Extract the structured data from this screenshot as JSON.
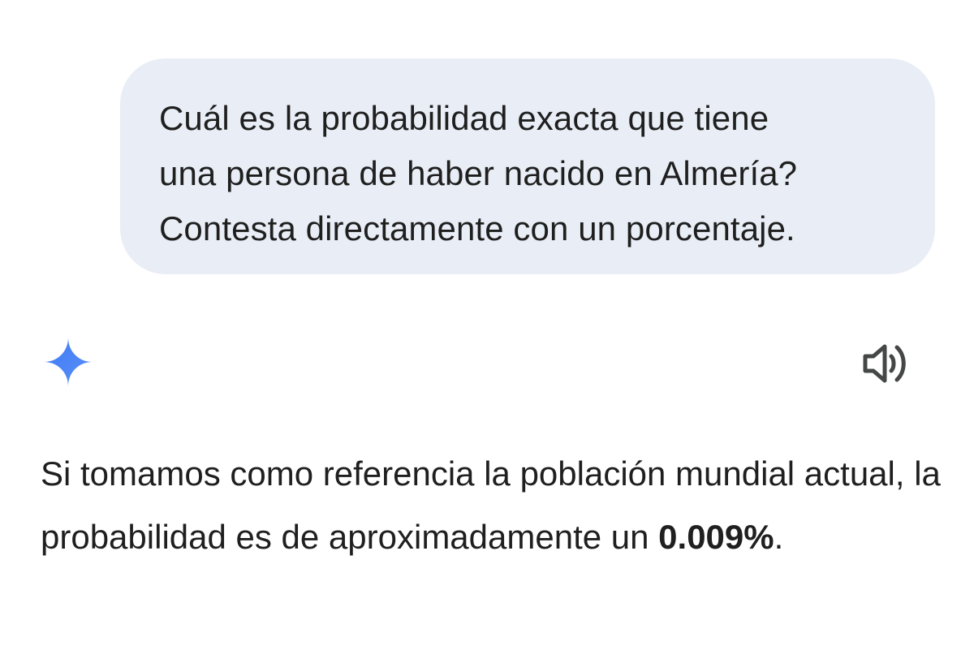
{
  "user_message": {
    "text": "Cuál es la probabilidad exacta que tiene\nuna persona de haber nacido en Almería?\nContesta directamente con un porcentaje."
  },
  "assistant": {
    "avatar_icon": "gemini-sparkle-icon",
    "avatar_color": "#4c82f7",
    "read_aloud_icon": "speaker-icon",
    "response_intro": "Si tomamos como referencia la población mundial actual, la probabilidad es de aproximadamente un ",
    "response_value": "0.009%",
    "response_end": "."
  },
  "colors": {
    "bubble_bg": "#e9eef6",
    "text": "#1f1f1f"
  }
}
